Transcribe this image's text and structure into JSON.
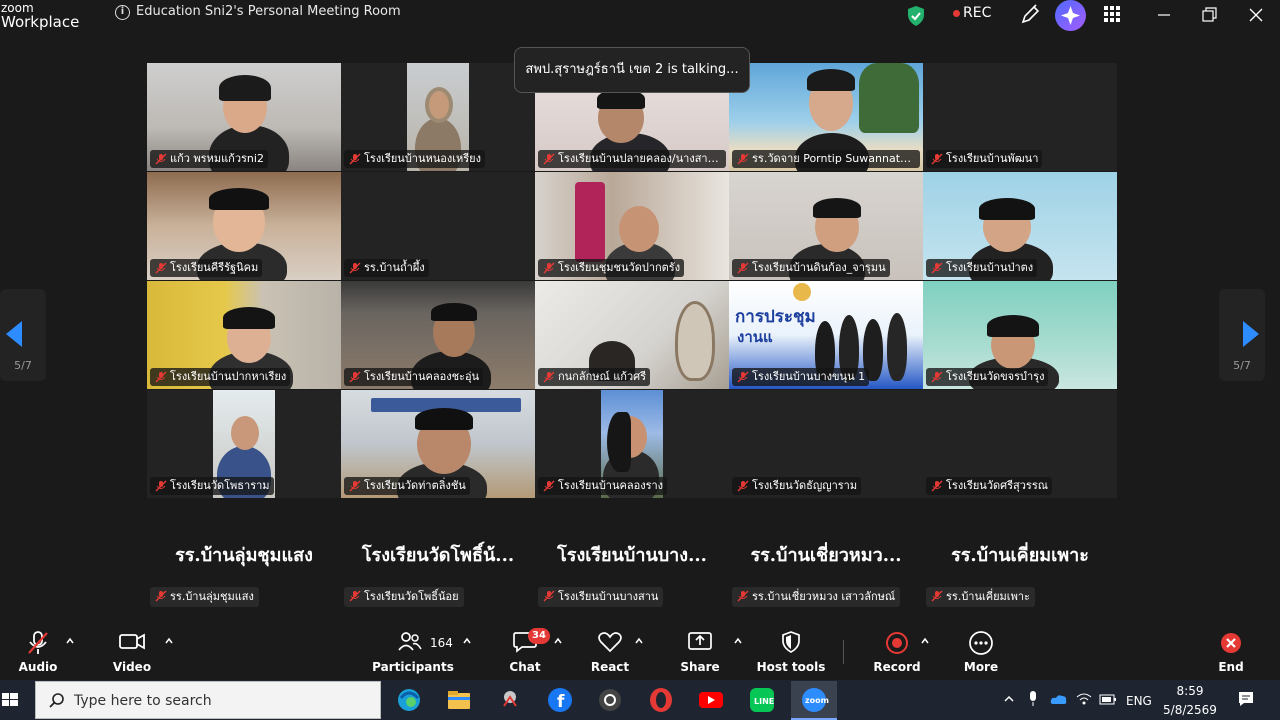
{
  "window": {
    "logo_line1": "zoom",
    "logo_line2": "Workplace",
    "meeting_title": "Education Sni2's Personal Meeting Room",
    "rec_label": "REC"
  },
  "stage": {
    "talking_banner": "สพป.สุราษฎร์ธานี เขต 2 is talking...",
    "page_indicator": "5/7",
    "tiles": [
      {
        "label": "แก้ว พรหมแก้วรni2"
      },
      {
        "label": "โรงเรียนบ้านหนองเหรียง"
      },
      {
        "label": "โรงเรียนบ้านปลายคลอง/นางสาวน..."
      },
      {
        "label": "รร.วัดจาย Porntip Suwannata..."
      },
      {
        "label": "โรงเรียนบ้านพัฒนา"
      },
      {
        "label": "โรงเรียนคีรีรัฐนิคม"
      },
      {
        "label": "รร.บ้านถ้ำผึ้ง"
      },
      {
        "label": "โรงเรียนชุมชนวัดปากตรัง"
      },
      {
        "label": "โรงเรียนบ้านดินก้อง_จารุมน"
      },
      {
        "label": "โรงเรียนบ้านป่าตง"
      },
      {
        "label": "โรงเรียนบ้านปากหาเรียง"
      },
      {
        "label": "โรงเรียนบ้านคลองชะอุ่น"
      },
      {
        "label": "กนกลักษณ์ แก้วศรี"
      },
      {
        "label": "โรงเรียนบ้านบางขนุน 1"
      },
      {
        "label": "โรงเรียนวัดขจรบำรุง"
      },
      {
        "label": "โรงเรียนวัดโพธาราม"
      },
      {
        "label": "โรงเรียนวัดท่าตลิ่งชัน"
      },
      {
        "label": "โรงเรียนบ้านคลองราง"
      },
      {
        "label": "โรงเรียนวัดธัญญาราม"
      },
      {
        "label": "โรงเรียนวัดศรีสุวรรณ"
      }
    ],
    "poster_text": "การประชุม",
    "poster_sub": "งานแ",
    "bottom_row": [
      {
        "big": "รร.บ้านลุ่มชุมแสง",
        "label": "รร.บ้านลุ่มชุมแสง"
      },
      {
        "big": "โรงเรียนวัดโพธิ์น้...",
        "label": "โรงเรียนวัดโพธิ์น้อย"
      },
      {
        "big": "โรงเรียนบ้านบาง...",
        "label": "โรงเรียนบ้านบางสาน"
      },
      {
        "big": "รร.บ้านเชี่ยวหมว...",
        "label": "รร.บ้านเชี่ยวหมวง เสาวลักษณ์"
      },
      {
        "big": "รร.บ้านเคี่ยมเพาะ",
        "label": "รร.บ้านเคี่ยมเพาะ"
      }
    ]
  },
  "toolbar": {
    "audio": "Audio",
    "video": "Video",
    "participants": "Participants",
    "participants_count": "164",
    "chat": "Chat",
    "chat_badge": "34",
    "react": "React",
    "share": "Share",
    "host_tools": "Host tools",
    "record": "Record",
    "more": "More",
    "end": "End"
  },
  "taskbar": {
    "search_placeholder": "Type here to search",
    "lang": "ENG",
    "time": "8:59",
    "date": "5/8/2569"
  },
  "colors": {
    "accent": "#2d8cff",
    "record_red": "#e53935",
    "mute_red": "#e53935"
  }
}
